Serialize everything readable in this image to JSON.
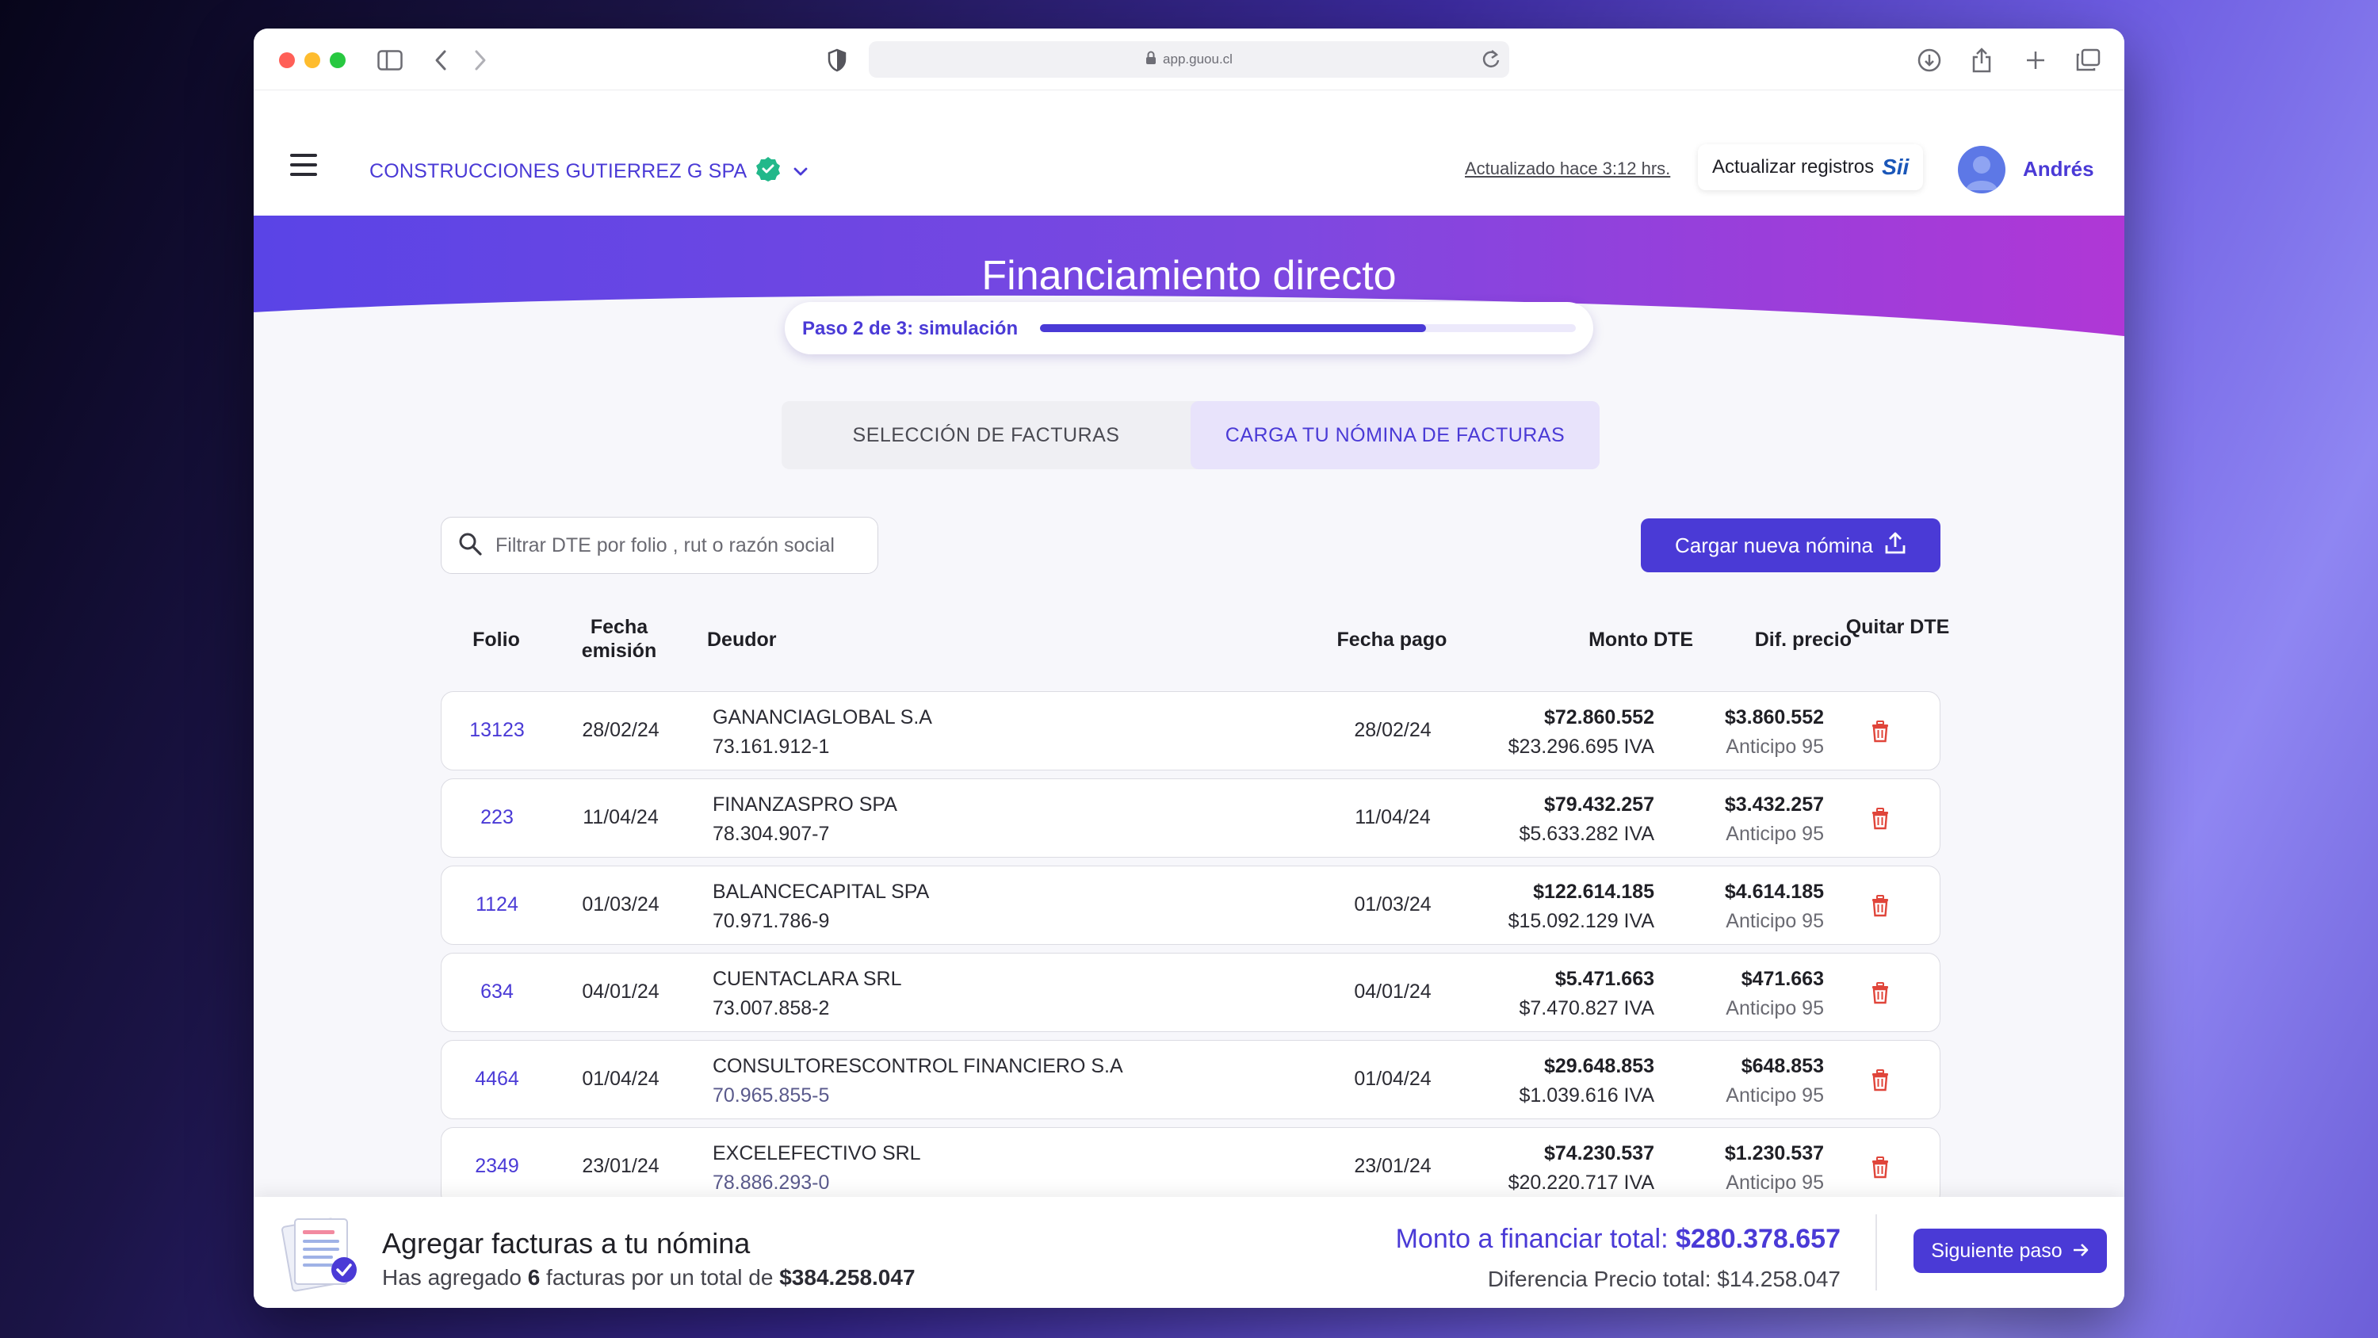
{
  "browser": {
    "url": "app.guou.cl"
  },
  "header": {
    "company": "CONSTRUCCIONES GUTIERREZ G SPA",
    "updated": "Actualizado hace 3:12 hrs.",
    "update_button": "Actualizar registros",
    "sii_logo_text": "Sii",
    "user_name": "Andrés"
  },
  "banner": {
    "title": "Financiamiento directo",
    "step_label": "Paso 2 de 3: simulación",
    "step_progress": 0.72
  },
  "tabs": [
    {
      "label": "SELECCIÓN DE FACTURAS",
      "active": false
    },
    {
      "label": "CARGA TU NÓMINA DE FACTURAS",
      "active": true
    }
  ],
  "search": {
    "placeholder": "Filtrar DTE por folio , rut o razón social"
  },
  "upload_button": "Cargar nueva nómina",
  "table": {
    "headers": {
      "folio": "Folio",
      "fecha_emision": "Fecha emisión",
      "deudor": "Deudor",
      "fecha_pago": "Fecha pago",
      "monto": "Monto DTE",
      "dif": "Dif. precio",
      "quitar": "Quitar DTE"
    },
    "rows": [
      {
        "folio": "13123",
        "fecha_emision": "28/02/24",
        "deudor": "GANANCIAGLOBAL S.A",
        "rut": "73.161.912-1",
        "fecha_pago": "28/02/24",
        "monto": "$72.860.552",
        "iva": "$23.296.695 IVA",
        "dif": "$3.860.552",
        "anticipo": "Anticipo 95"
      },
      {
        "folio": "223",
        "fecha_emision": "11/04/24",
        "deudor": "FINANZASPRO SPA",
        "rut": "78.304.907-7",
        "fecha_pago": "11/04/24",
        "monto": "$79.432.257",
        "iva": "$5.633.282 IVA",
        "dif": "$3.432.257",
        "anticipo": "Anticipo 95"
      },
      {
        "folio": "1124",
        "fecha_emision": "01/03/24",
        "deudor": "BALANCECAPITAL SPA",
        "rut": "70.971.786-9",
        "fecha_pago": "01/03/24",
        "monto": "$122.614.185",
        "iva": "$15.092.129 IVA",
        "dif": "$4.614.185",
        "anticipo": "Anticipo 95"
      },
      {
        "folio": "634",
        "fecha_emision": "04/01/24",
        "deudor": "CUENTACLARA SRL",
        "rut": "73.007.858-2",
        "fecha_pago": "04/01/24",
        "monto": "$5.471.663",
        "iva": "$7.470.827 IVA",
        "dif": "$471.663",
        "anticipo": "Anticipo 95"
      },
      {
        "folio": "4464",
        "fecha_emision": "01/04/24",
        "deudor": "CONSULTORESCONTROL FINANCIERO S.A",
        "rut": "70.965.855-5",
        "fecha_pago": "01/04/24",
        "monto": "$29.648.853",
        "iva": "$1.039.616 IVA",
        "dif": "$648.853",
        "anticipo": "Anticipo 95"
      },
      {
        "folio": "2349",
        "fecha_emision": "23/01/24",
        "deudor": "EXCELEFECTIVO SRL",
        "rut": "78.886.293-0",
        "fecha_pago": "23/01/24",
        "monto": "$74.230.537",
        "iva": "$20.220.717 IVA",
        "dif": "$1.230.537",
        "anticipo": "Anticipo 95"
      }
    ]
  },
  "footer": {
    "title": "Agregar facturas a tu nómina",
    "sub_prefix": "Has agregado",
    "count": "6",
    "sub_middle": "facturas por un total de",
    "sub_total": "$384.258.047",
    "total_label": "Monto a financiar total:",
    "total_value": "$280.378.657",
    "diff_label": "Diferencia Precio total:",
    "diff_value": "$14.258.047",
    "next_button": "Siguiente paso"
  },
  "colors": {
    "accent": "#4a3ad6",
    "banner_start": "#5a44e6",
    "banner_end": "#b037d6",
    "danger": "#e0453a"
  }
}
